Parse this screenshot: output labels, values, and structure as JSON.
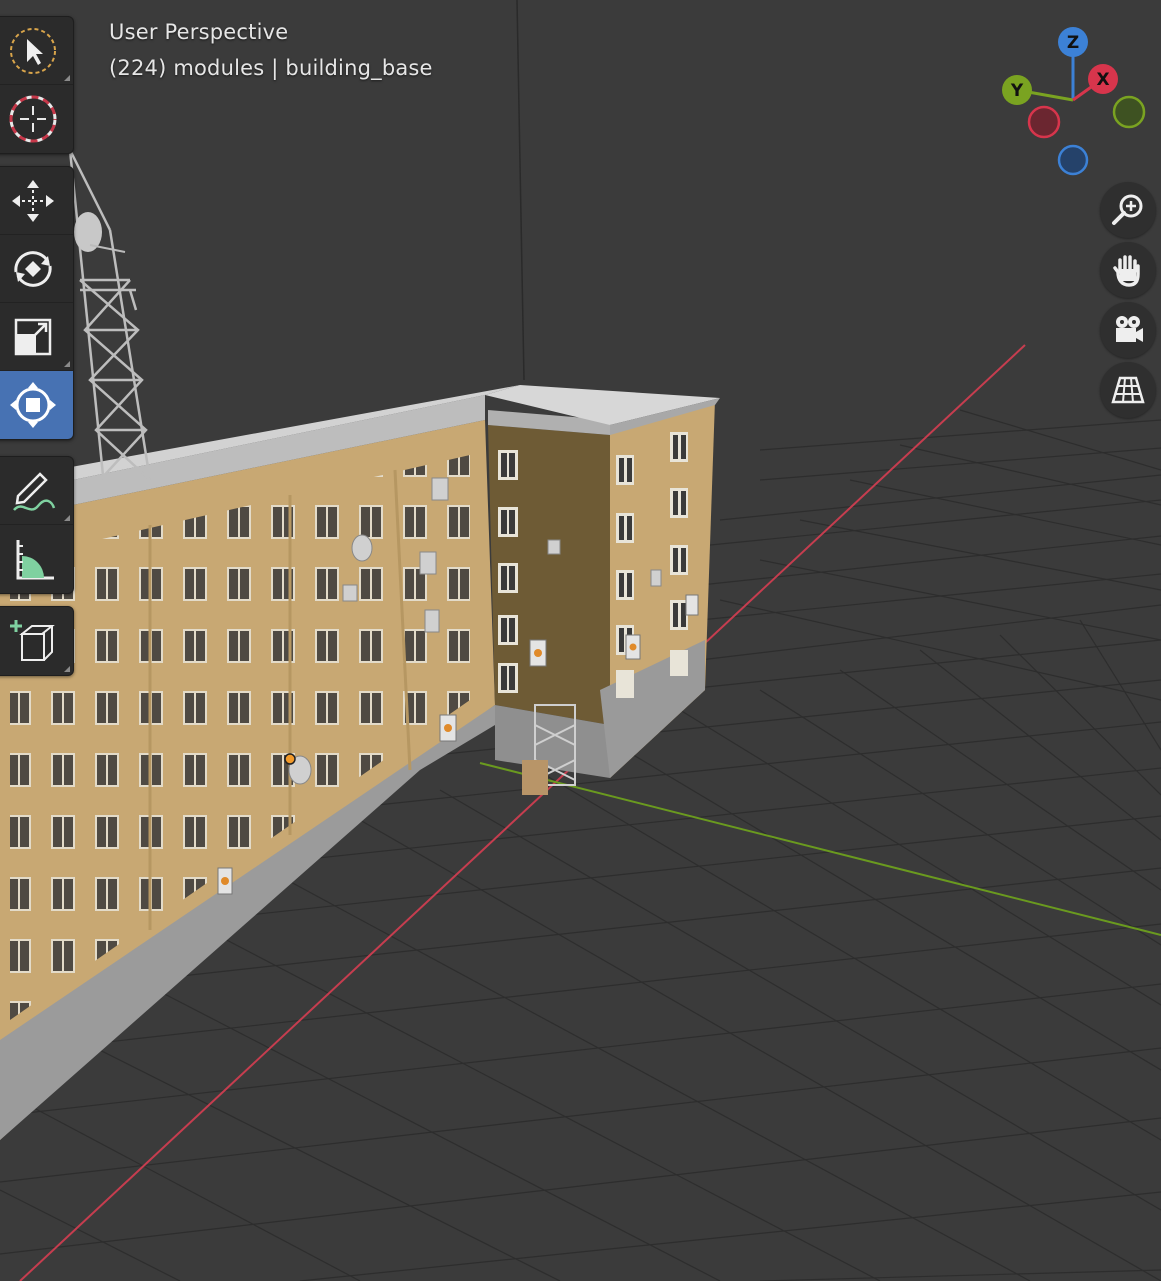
{
  "viewport": {
    "view_name": "User Perspective",
    "context": "(224) modules | building_base",
    "background_color": "#3a3a3a",
    "grid_color": "#2f2f2f",
    "x_axis_color": "#c63d4f",
    "y_axis_color": "#6a9a1f"
  },
  "toolbar": {
    "tools": [
      {
        "name": "select-box-tool",
        "icon": "cursor-select-icon",
        "active": false
      },
      {
        "name": "cursor-tool",
        "icon": "3d-cursor-icon",
        "active": false
      },
      {
        "name": "move-tool",
        "icon": "move-arrows-icon",
        "active": false
      },
      {
        "name": "rotate-tool",
        "icon": "rotate-icon",
        "active": false
      },
      {
        "name": "scale-tool",
        "icon": "scale-icon",
        "active": false
      },
      {
        "name": "transform-tool",
        "icon": "transform-icon",
        "active": true
      },
      {
        "name": "annotate-tool",
        "icon": "annotate-pencil-icon",
        "active": false
      },
      {
        "name": "measure-tool",
        "icon": "measure-ruler-icon",
        "active": false
      },
      {
        "name": "add-cube-tool",
        "icon": "add-cube-icon",
        "active": false
      }
    ],
    "active_color": "#4772b3"
  },
  "gizmo": {
    "z_label": "Z",
    "y_label": "Y",
    "x_label": "X",
    "x_color": "#d7354c",
    "y_color": "#7aa321",
    "z_color": "#3c81d6"
  },
  "nav_buttons": [
    {
      "name": "zoom-button",
      "icon": "zoom-in-icon"
    },
    {
      "name": "pan-button",
      "icon": "hand-icon"
    },
    {
      "name": "camera-view-button",
      "icon": "camera-icon"
    },
    {
      "name": "perspective-toggle-button",
      "icon": "grid-perspective-icon"
    }
  ]
}
